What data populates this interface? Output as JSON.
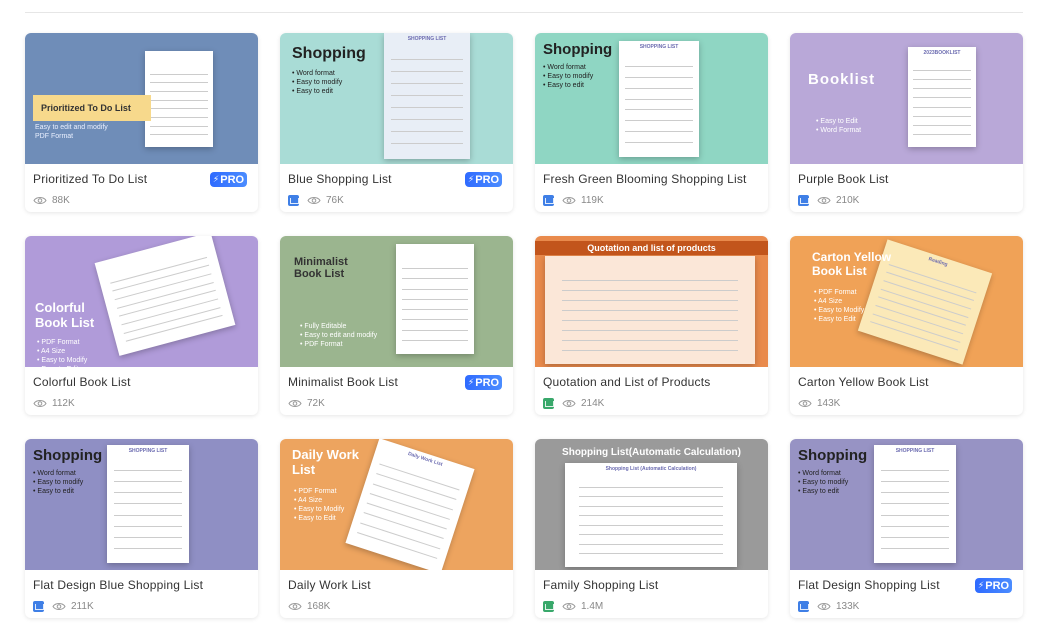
{
  "cards": [
    {
      "title": "Prioritized To Do List",
      "views": "88K",
      "pro": true,
      "file": "",
      "bg": "#6f8db8",
      "thumb": {
        "heading": "Prioritized To Do List",
        "lines": [
          "Easy to edit and modify",
          "PDF Format"
        ]
      }
    },
    {
      "title": "Blue Shopping List",
      "views": "76K",
      "pro": true,
      "file": "word",
      "bg": "#a9dcd6",
      "thumb": {
        "heading": "Shopping",
        "lines": [
          "• Word format",
          "• Easy to modify",
          "• Easy to edit"
        ],
        "doc_title": "SHOPPING LIST"
      }
    },
    {
      "title": "Fresh Green Blooming Shopping List",
      "views": "119K",
      "pro": false,
      "file": "word",
      "bg": "#8fd6c3",
      "thumb": {
        "heading": "Shopping",
        "lines": [
          "• Word format",
          "• Easy to modify",
          "• Easy to edit"
        ],
        "doc_title": "SHOPPING LIST"
      }
    },
    {
      "title": "Purple Book List",
      "views": "210K",
      "pro": false,
      "file": "word",
      "bg": "#b9a8d8",
      "thumb": {
        "heading": "Booklist",
        "lines": [
          "• Easy to Edit",
          "• Word Format"
        ],
        "doc_title": "2023BOOKLIST"
      }
    },
    {
      "title": "Colorful Book List",
      "views": "112K",
      "pro": false,
      "file": "",
      "bg": "#b09bd9",
      "thumb": {
        "heading": "Colorful Book List",
        "lines": [
          "• PDF Format",
          "• A4 Size",
          "• Easy to Modify",
          "• Easy to Edit"
        ]
      }
    },
    {
      "title": "Minimalist Book List",
      "views": "72K",
      "pro": true,
      "file": "",
      "bg": "#9bb58f",
      "thumb": {
        "heading": "Minimalist Book List",
        "lines": [
          "• Fully Editable",
          "• Easy to edit and modify",
          "• PDF Format"
        ]
      }
    },
    {
      "title": "Quotation and List of Products",
      "views": "214K",
      "pro": false,
      "file": "sheet",
      "bg": "#e98a4c",
      "thumb": {
        "heading": "Quotation and list of products",
        "lines": []
      }
    },
    {
      "title": "Carton Yellow Book List",
      "views": "143K",
      "pro": false,
      "file": "",
      "bg": "#f0a257",
      "thumb": {
        "heading": "Carton Yellow Book List",
        "lines": [
          "• PDF Format",
          "• A4 Size",
          "• Easy to Modify",
          "• Easy to Edit"
        ],
        "doc_title": "Reading"
      }
    },
    {
      "title": "Flat Design Blue Shopping List",
      "views": "211K",
      "pro": false,
      "file": "word",
      "bg": "#8f8fc4",
      "thumb": {
        "heading": "Shopping",
        "lines": [
          "• Word format",
          "• Easy to modify",
          "• Easy to edit"
        ],
        "doc_title": "SHOPPING LIST"
      }
    },
    {
      "title": "Daily Work List",
      "views": "168K",
      "pro": false,
      "file": "",
      "bg": "#eda45f",
      "thumb": {
        "heading": "Daily Work List",
        "lines": [
          "• PDF Format",
          "• A4 Size",
          "• Easy to Modify",
          "• Easy to Edit"
        ],
        "doc_title": "Daily Work List"
      }
    },
    {
      "title": "Family Shopping List",
      "views": "1.4M",
      "pro": false,
      "file": "sheet",
      "bg": "#9a9a9a",
      "thumb": {
        "heading": "Shopping List(Automatic Calculation)",
        "lines": [],
        "doc_title": "Shopping List (Automatic Calculation)"
      }
    },
    {
      "title": "Flat Design Shopping List",
      "views": "133K",
      "pro": true,
      "file": "word",
      "bg": "#9793c4",
      "thumb": {
        "heading": "Shopping",
        "lines": [
          "• Word format",
          "• Easy to modify",
          "• Easy to edit"
        ],
        "doc_title": "SHOPPING LIST"
      }
    }
  ],
  "pro_label": "PRO",
  "pro_glyph": "⚡"
}
